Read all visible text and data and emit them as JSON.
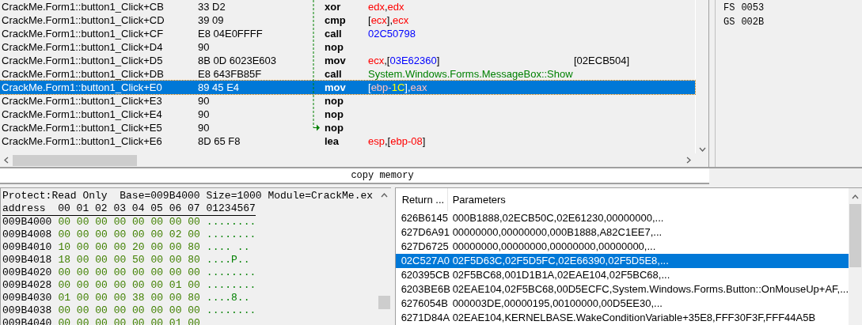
{
  "disassembly": {
    "rows": [
      {
        "address": "CrackMe.Form1::button1_Click+CB",
        "bytes": "33 D2",
        "mnemonic": "xor",
        "operands": [
          {
            "kind": "reg",
            "text": "edx"
          },
          {
            "kind": "punct",
            "text": ","
          },
          {
            "kind": "reg",
            "text": "edx"
          }
        ],
        "selected": false
      },
      {
        "address": "CrackMe.Form1::button1_Click+CD",
        "bytes": "39 09",
        "mnemonic": "cmp",
        "operands": [
          {
            "kind": "punct",
            "text": "["
          },
          {
            "kind": "reg",
            "text": "ecx"
          },
          {
            "kind": "punct",
            "text": "],"
          },
          {
            "kind": "reg",
            "text": "ecx"
          }
        ],
        "selected": false
      },
      {
        "address": "CrackMe.Form1::button1_Click+CF",
        "bytes": "E8 04E0FFFF",
        "mnemonic": "call",
        "operands": [
          {
            "kind": "imm",
            "text": "02C50798"
          }
        ],
        "selected": false
      },
      {
        "address": "CrackMe.Form1::button1_Click+D4",
        "bytes": "90",
        "mnemonic": "nop",
        "selected": false
      },
      {
        "address": "CrackMe.Form1::button1_Click+D5",
        "bytes": "8B 0D 6023E603",
        "mnemonic": "mov",
        "operands": [
          {
            "kind": "reg",
            "text": "ecx"
          },
          {
            "kind": "punct",
            "text": ",["
          },
          {
            "kind": "imm",
            "text": "03E62360"
          },
          {
            "kind": "punct",
            "text": "]"
          }
        ],
        "comment": "[02ECB504]",
        "selected": false
      },
      {
        "address": "CrackMe.Form1::button1_Click+DB",
        "bytes": "E8 643FB85F",
        "mnemonic": "call",
        "operands": [
          {
            "kind": "sym",
            "text": "System.Windows.Forms.MessageBox::Show"
          }
        ],
        "selected": false
      },
      {
        "address": "CrackMe.Form1::button1_Click+E0",
        "bytes": "89 45 E4",
        "mnemonic": "mov",
        "operands": [
          {
            "kind": "punct",
            "text": "["
          },
          {
            "kind": "reg",
            "text": "ebp-"
          },
          {
            "kind": "imm",
            "text": "1C"
          },
          {
            "kind": "punct",
            "text": "],"
          },
          {
            "kind": "reg",
            "text": "eax"
          }
        ],
        "selected": true
      },
      {
        "address": "CrackMe.Form1::button1_Click+E3",
        "bytes": "90",
        "mnemonic": "nop",
        "selected": false
      },
      {
        "address": "CrackMe.Form1::button1_Click+E4",
        "bytes": "90",
        "mnemonic": "nop",
        "selected": false
      },
      {
        "address": "CrackMe.Form1::button1_Click+E5",
        "bytes": "90",
        "mnemonic": "nop",
        "selected": false
      },
      {
        "address": "CrackMe.Form1::button1_Click+E6",
        "bytes": "8D 65 F8",
        "mnemonic": "lea",
        "operands": [
          {
            "kind": "reg",
            "text": "esp"
          },
          {
            "kind": "punct",
            "text": ",["
          },
          {
            "kind": "reg",
            "text": "ebp-08"
          },
          {
            "kind": "punct",
            "text": "]"
          }
        ],
        "selected": false
      }
    ]
  },
  "registers": [
    {
      "name": "FS",
      "value": "0053"
    },
    {
      "name": "GS",
      "value": "002B"
    }
  ],
  "copy_bar": {
    "label": "copy memory"
  },
  "memory": {
    "info": "Protect:Read Only  Base=009B4000 Size=1000 Module=CrackMe.ex",
    "header": "address  00 01 02 03 04 05 06 07 01234567",
    "rows": [
      {
        "address": "009B4000",
        "bytes": "00 00 00 00 00 00 00 00",
        "ascii": "........"
      },
      {
        "address": "009B4008",
        "bytes": "00 00 00 00 00 00 02 00",
        "ascii": "........"
      },
      {
        "address": "009B4010",
        "bytes": "10 00 00 00 20 00 00 80",
        "ascii": ".... .."
      },
      {
        "address": "009B4018",
        "bytes": "18 00 00 00 50 00 00 80",
        "ascii": "....P.."
      },
      {
        "address": "009B4020",
        "bytes": "00 00 00 00 00 00 00 00",
        "ascii": "........"
      },
      {
        "address": "009B4028",
        "bytes": "00 00 00 00 00 00 01 00",
        "ascii": "........"
      },
      {
        "address": "009B4030",
        "bytes": "01 00 00 00 38 00 00 80",
        "ascii": "....8.."
      },
      {
        "address": "009B4038",
        "bytes": "00 00 00 00 00 00 00 00",
        "ascii": "........"
      },
      {
        "address": "009B4040",
        "bytes": "00 00 00 00 00 00 01 00"
      }
    ]
  },
  "call_stack": {
    "columns": [
      "Return ...",
      "Parameters"
    ],
    "rows": [
      {
        "return": "626B6145",
        "parameters": "000B1888,02ECB50C,02E61230,00000000,...",
        "selected": false
      },
      {
        "return": "627D6A91",
        "parameters": "00000000,00000000,000B1888,A82C1EE7,...",
        "selected": false
      },
      {
        "return": "627D6725",
        "parameters": "00000000,00000000,00000000,00000000,...",
        "selected": false
      },
      {
        "return": "02C527A0",
        "parameters": "02F5D63C,02F5D5FC,02E66390,02F5D5E8,...",
        "selected": true
      },
      {
        "return": "620395CB",
        "parameters": "02F5BC68,001D1B1A,02EAE104,02F5BC68,...",
        "selected": false
      },
      {
        "return": "6203BE6B",
        "parameters": "02EAE104,02F5BC68,00D5ECFC,System.Windows.Forms.Button::OnMouseUp+AF,...",
        "selected": false
      },
      {
        "return": "6276054B",
        "parameters": "000003DE,00000195,00100000,00D5EE30,...",
        "selected": false
      },
      {
        "return": "6271D84A",
        "parameters": "02EAE104,KERNELBASE.WakeConditionVariable+35E8,FFF30F3F,FFF44A5B",
        "selected": false
      }
    ]
  }
}
